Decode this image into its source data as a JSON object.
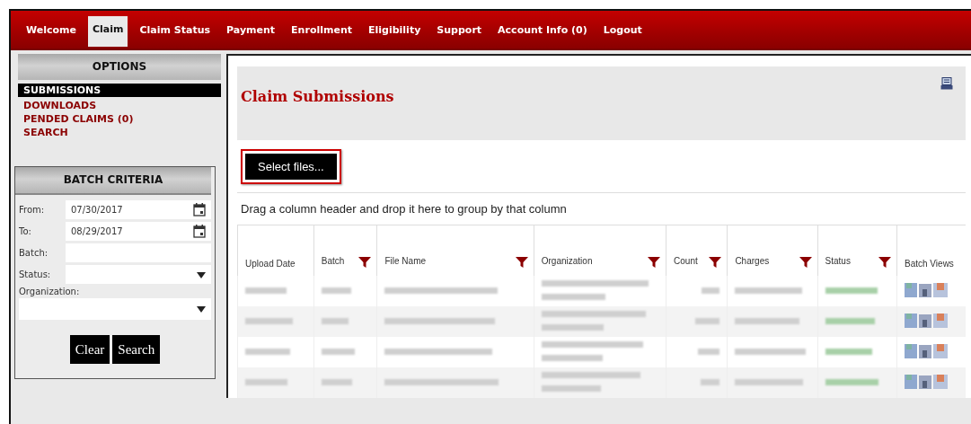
{
  "nav": [
    {
      "label": "Welcome",
      "selected": false
    },
    {
      "label": "Claim",
      "selected": true
    },
    {
      "label": "Claim Status",
      "selected": false
    },
    {
      "label": "Payment",
      "selected": false
    },
    {
      "label": "Enrollment",
      "selected": false
    },
    {
      "label": "Eligibility",
      "selected": false
    },
    {
      "label": "Support",
      "selected": false
    },
    {
      "label": "Account Info (0)",
      "selected": false
    },
    {
      "label": "Logout",
      "selected": false
    }
  ],
  "options": {
    "title": "OPTIONS",
    "items": [
      {
        "label": "SUBMISSIONS",
        "selected": true
      },
      {
        "label": "DOWNLOADS",
        "selected": false
      },
      {
        "label": "PENDED CLAIMS (0)",
        "selected": false
      },
      {
        "label": "SEARCH",
        "selected": false
      }
    ]
  },
  "batch_criteria": {
    "title": "BATCH CRITERIA",
    "fields": [
      {
        "label": "From:",
        "kind": "date",
        "value": "07/30/2017"
      },
      {
        "label": "To:",
        "kind": "date",
        "value": "08/29/2017"
      },
      {
        "label": "Batch:",
        "kind": "text"
      },
      {
        "label": "Status:",
        "kind": "select"
      },
      {
        "label": "Organization:",
        "kind": "select-wide"
      }
    ],
    "buttons": [
      "Clear",
      "Search"
    ]
  },
  "main": {
    "title": "Claim Submissions",
    "upload_button": "Select files...",
    "group_hint": "Drag a column header and drop it here to group by that column",
    "table": {
      "columns": [
        {
          "label": "Upload Date",
          "filter": false
        },
        {
          "label": "Batch",
          "filter": true
        },
        {
          "label": "File Name",
          "filter": true
        },
        {
          "label": "Organization",
          "filter": true
        },
        {
          "label": "Count",
          "filter": true
        },
        {
          "label": "Charges",
          "filter": true
        },
        {
          "label": "Status",
          "filter": true
        },
        {
          "label": "Batch Views",
          "filter": false
        }
      ],
      "rows": [
        {
          "kind": "blurred"
        },
        {
          "kind": "blurred"
        },
        {
          "kind": "blurred"
        },
        {
          "kind": "blurred"
        }
      ]
    }
  }
}
